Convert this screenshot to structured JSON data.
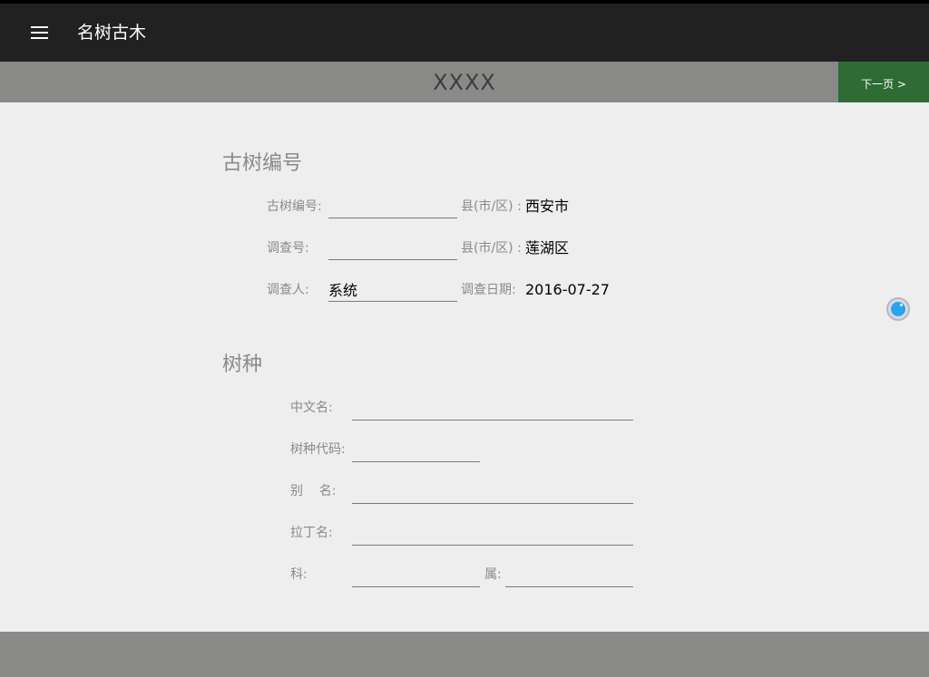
{
  "app": {
    "title": "名树古木"
  },
  "subbar": {
    "title": "XXXX",
    "next_label": "下一页 >"
  },
  "section_number": {
    "title": "古树编号",
    "tree_number_label": "古树编号:",
    "tree_number_value": "",
    "county1_label": "县(市/区) :",
    "county1_value": "西安市",
    "survey_number_label": "调查号:",
    "survey_number_value": "",
    "county2_label": "县(市/区) :",
    "county2_value": "莲湖区",
    "surveyor_label": "调查人:",
    "surveyor_value": "系统",
    "survey_date_label": "调查日期:",
    "survey_date_value": "2016-07-27"
  },
  "section_species": {
    "title": "树种",
    "chinese_name_label": "中文名:",
    "chinese_name_value": "",
    "species_code_label": "树种代码:",
    "species_code_value": "",
    "alias_label": "别    名:",
    "alias_value": "",
    "latin_name_label": "拉丁名:",
    "latin_name_value": "",
    "family_label": "科:",
    "family_value": "",
    "genus_label": "属:",
    "genus_value": ""
  },
  "colors": {
    "appbar": "#212121",
    "subbar": "#898a88",
    "next_button": "#2f6b35",
    "background": "#eeeeee",
    "accent_dot": "#2aa3f2"
  },
  "icons": {
    "menu": "menu-icon",
    "floating": "floating-assist-icon"
  }
}
